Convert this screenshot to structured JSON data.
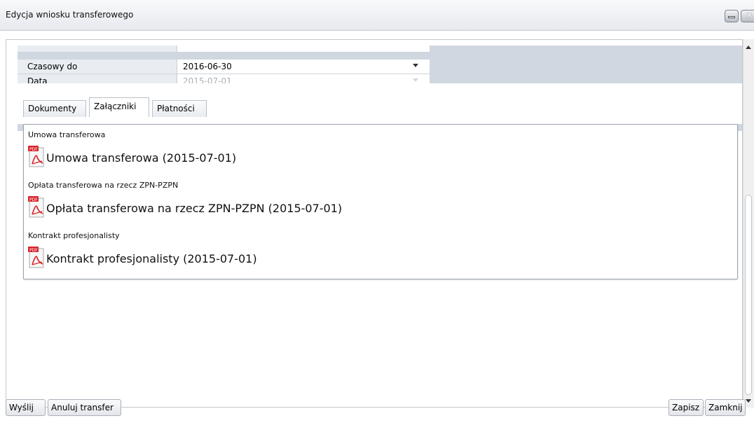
{
  "window": {
    "title": "Edycja wniosku transferowego"
  },
  "form": {
    "rows": [
      {
        "label": "Czasowy do",
        "value": "2016-06-30",
        "enabled": true
      },
      {
        "label": "Data",
        "value": "2015-07-01",
        "enabled": false
      }
    ]
  },
  "tabs": [
    {
      "label": "Dokumenty",
      "active": false
    },
    {
      "label": "Załączniki",
      "active": true
    },
    {
      "label": "Płatności",
      "active": false
    }
  ],
  "attachments": [
    {
      "category": "Umowa transferowa",
      "file": "Umowa transferowa (2015-07-01)",
      "icon": "pdf-icon"
    },
    {
      "category": "Opłata transferowa na rzecz ZPN-PZPN",
      "file": "Opłata transferowa na rzecz ZPN-PZPN (2015-07-01)",
      "icon": "pdf-icon"
    },
    {
      "category": "Kontrakt profesjonalisty",
      "file": "Kontrakt profesjonalisty (2015-07-01)",
      "icon": "pdf-icon"
    }
  ],
  "buttons": {
    "send": "Wyślij",
    "cancel_transfer": "Anuluj transfer",
    "save": "Zapisz",
    "close": "Zamknij"
  },
  "colors": {
    "form_background": "#d0d7e0",
    "pdf_red": "#d8232a"
  }
}
